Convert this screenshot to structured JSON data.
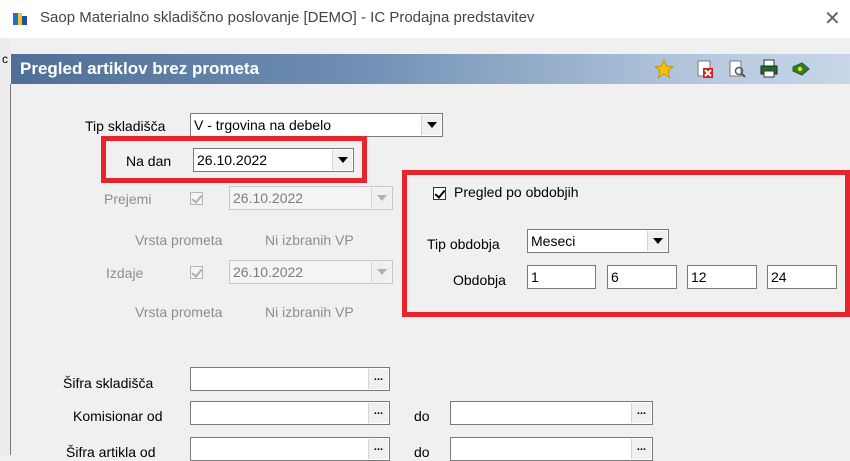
{
  "window": {
    "title": "Saop Materialno skladiščno poslovanje [DEMO] - IC Prodajna predstavitev",
    "close_glyph": "✕"
  },
  "side": {
    "letter": "c"
  },
  "header": {
    "title": "Pregled artiklov brez prometa",
    "tools": [
      "star-icon",
      "delete-report-icon",
      "preview-icon",
      "print-icon",
      "exit-icon"
    ]
  },
  "form": {
    "tip_skladisca": {
      "label": "Tip skladišča",
      "value": "V - trgovina na debelo"
    },
    "na_dan": {
      "label": "Na dan",
      "value": "26.10.2022"
    },
    "prejemi": {
      "label": "Prejemi",
      "checked": true,
      "date": "26.10.2022",
      "vrsta_label": "Vrsta prometa",
      "vrsta_value": "Ni izbranih VP"
    },
    "izdaje": {
      "label": "Izdaje",
      "checked": true,
      "date": "26.10.2022",
      "vrsta_label": "Vrsta prometa",
      "vrsta_value": "Ni izbranih VP"
    },
    "pregled_po_obdobjih": {
      "label": "Pregled po obdobjih",
      "checked": true
    },
    "tip_obdobja": {
      "label": "Tip obdobja",
      "value": "Meseci"
    },
    "obdobja": {
      "label": "Obdobja",
      "values": [
        "1",
        "6",
        "12",
        "24"
      ]
    },
    "sifra_skladisca": {
      "label": "Šifra skladišča",
      "value": ""
    },
    "komisionar": {
      "label_od": "Komisionar od",
      "label_do": "do",
      "od": "",
      "do": ""
    },
    "sifra_artikla": {
      "label_od": "Šifra artikla od",
      "label_do": "do",
      "od": "",
      "do": ""
    },
    "ellipsis": "..."
  },
  "colors": {
    "highlight": "#e8242f",
    "header_start": "#4f6f96",
    "header_end": "#c7d6e8"
  }
}
